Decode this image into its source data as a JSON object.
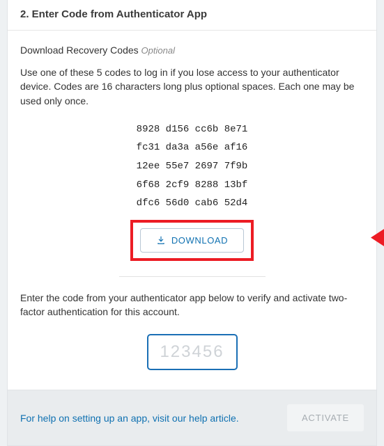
{
  "header": {
    "title": "2. Enter Code from Authenticator App"
  },
  "recovery": {
    "subhead": "Download Recovery Codes",
    "optional": "Optional",
    "description": "Use one of these 5 codes to log in if you lose access to your authenticator device. Codes are 16 characters long plus optional spaces. Each one may be used only once.",
    "codes": [
      "8928 d156 cc6b 8e71",
      "fc31 da3a a56e af16",
      "12ee 55e7 2697 7f9b",
      "6f68 2cf9 8288 13bf",
      "dfc6 56d0 cab6 52d4"
    ],
    "download_label": "DOWNLOAD"
  },
  "verify": {
    "instruction": "Enter the code from your authenticator app below to verify and activate two-factor authentication for this account.",
    "placeholder": "123456"
  },
  "footer": {
    "help_text": "For help on setting up an app, visit our help article.",
    "activate_label": "ACTIVATE"
  }
}
